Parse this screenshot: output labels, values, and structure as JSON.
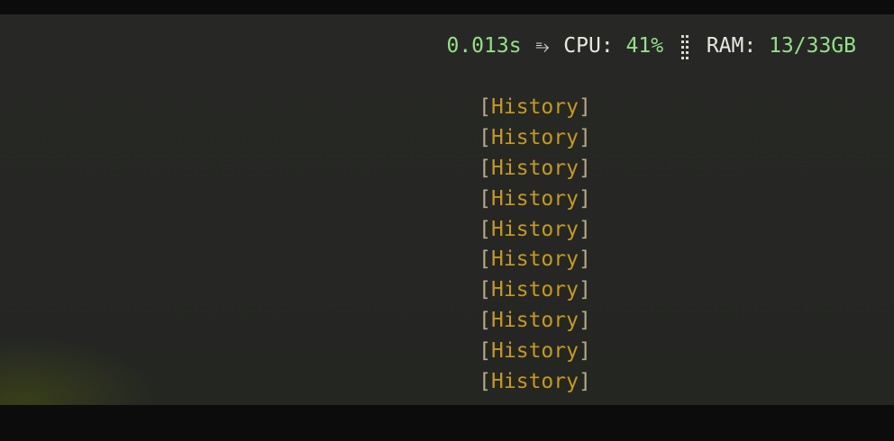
{
  "status": {
    "elapsed": "0.013s",
    "separator_icon": "⥱",
    "cpu_label": "CPU:",
    "cpu_value": "41%",
    "meter_icon": "braille-dots-icon",
    "ram_label": "RAM:",
    "ram_value": "13/33GB"
  },
  "history": {
    "bracket_open": "[",
    "bracket_close": "]",
    "items": [
      "History",
      "History",
      "History",
      "History",
      "History",
      "History",
      "History",
      "History",
      "History",
      "History"
    ]
  },
  "colors": {
    "background": "#262724",
    "status_value": "#93e089",
    "status_label": "#e8e8e0",
    "history_label": "#c59a1c",
    "bracket": "#b8ab88"
  }
}
